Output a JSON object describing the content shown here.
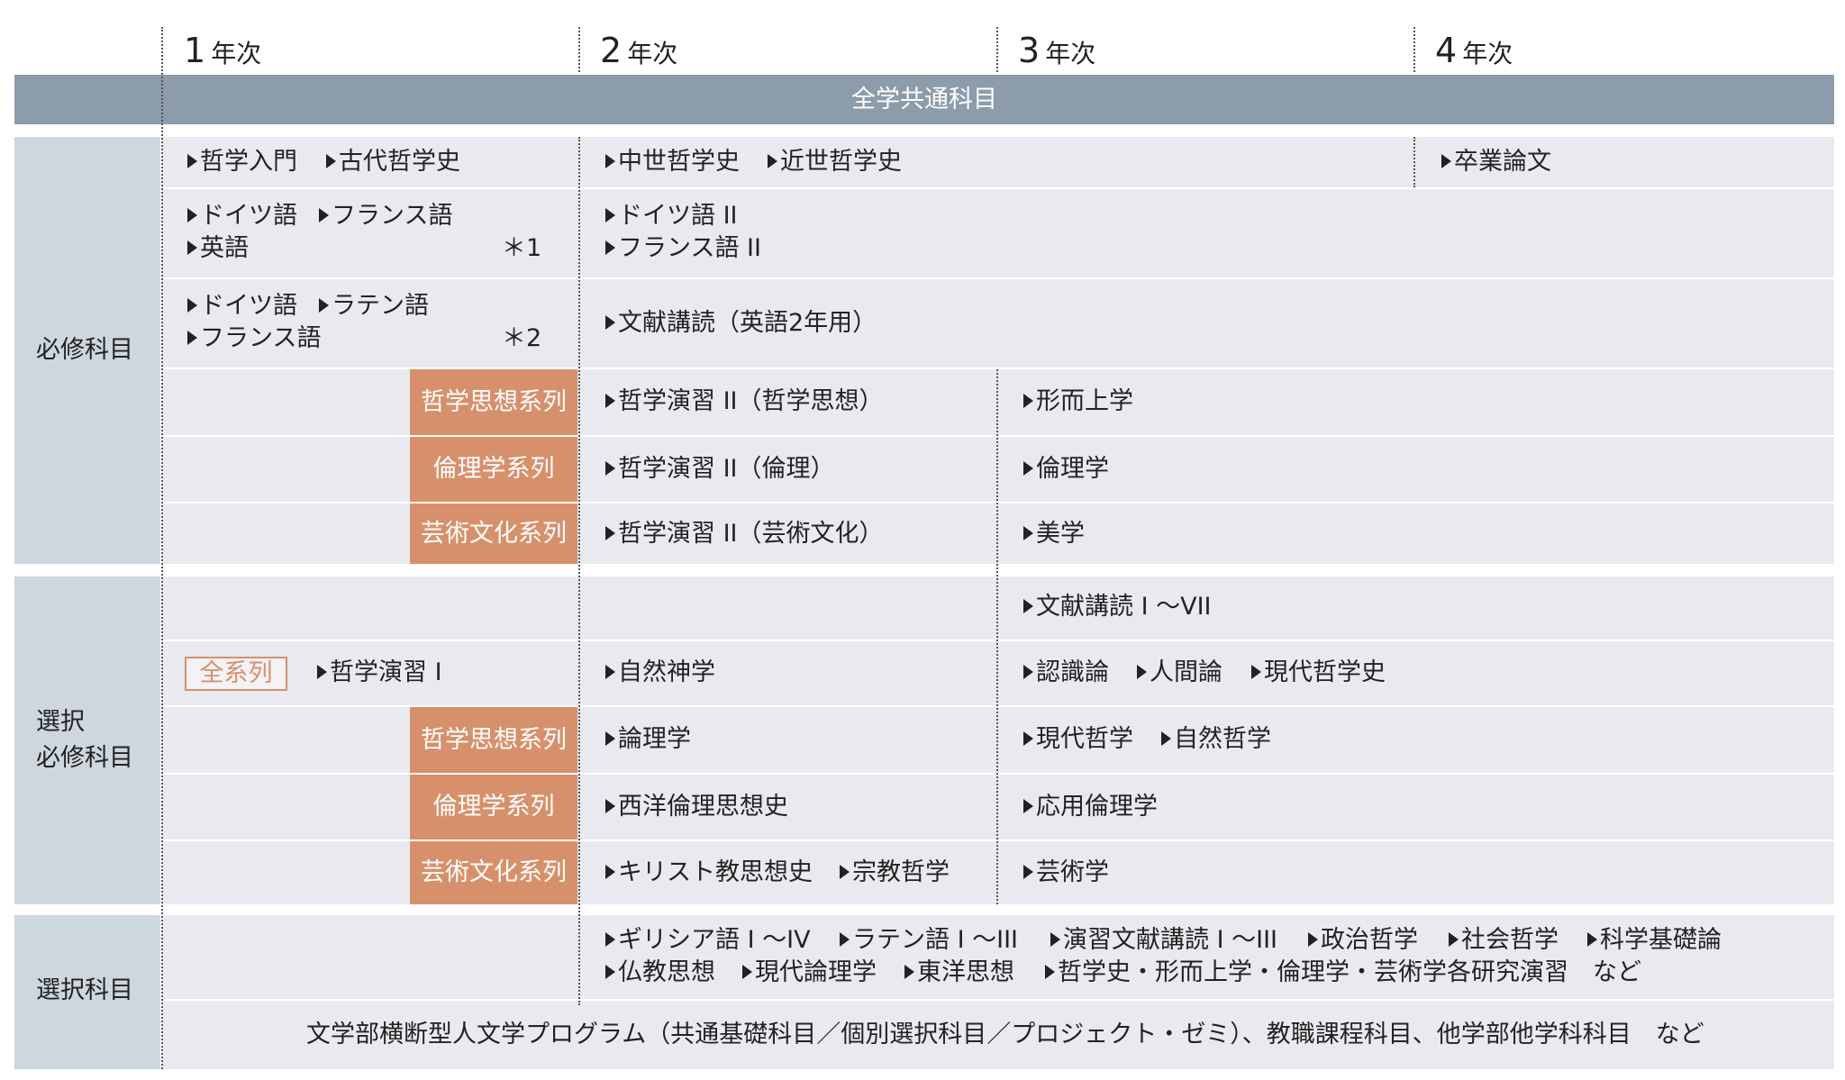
{
  "years": {
    "y1": {
      "num": "1",
      "label": "年次"
    },
    "y2": {
      "num": "2",
      "label": "年次"
    },
    "y3": {
      "num": "3",
      "label": "年次"
    },
    "y4": {
      "num": "4",
      "label": "年次"
    }
  },
  "common_band": "全学共通科目",
  "categories": {
    "required": "必修科目",
    "selective_required_1": "選択",
    "selective_required_2": "必修科目",
    "elective": "選択科目"
  },
  "series": {
    "philosophy": "哲学思想系列",
    "ethics": "倫理学系列",
    "art": "芸術文化系列",
    "all": "全系列"
  },
  "notes": {
    "n1": "＊1",
    "n2": "＊2"
  },
  "required": {
    "r1_y1_a": "哲学入門",
    "r1_y1_b": "古代哲学史",
    "r1_y2_a": "中世哲学史",
    "r1_y2_b": "近世哲学史",
    "r1_y4": "卒業論文",
    "r2_y1_a": "ドイツ語",
    "r2_y1_b": "フランス語",
    "r2_y1_c": "英語",
    "r2_y2_a": "ドイツ語 II",
    "r2_y2_b": "フランス語 II",
    "r3_y1_a": "ドイツ語",
    "r3_y1_b": "ラテン語",
    "r3_y1_c": "フランス語",
    "r3_y2": "文献講読（英語2年用）",
    "r4_y2": "哲学演習 II（哲学思想）",
    "r4_y3": "形而上学",
    "r5_y2": "哲学演習 II（倫理）",
    "r5_y3": "倫理学",
    "r6_y2": "哲学演習 II（芸術文化）",
    "r6_y3": "美学"
  },
  "selective": {
    "s1_y3": "文献講読 I 〜VII",
    "s2_y1": "哲学演習 I",
    "s2_y2": "自然神学",
    "s2_y3_a": "認識論",
    "s2_y3_b": "人間論",
    "s2_y3_c": "現代哲学史",
    "s3_y2": "論理学",
    "s3_y3_a": "現代哲学",
    "s3_y3_b": "自然哲学",
    "s4_y2": "西洋倫理思想史",
    "s4_y3": "応用倫理学",
    "s5_y2_a": "キリスト教思想史",
    "s5_y2_b": "宗教哲学",
    "s5_y3": "芸術学"
  },
  "elective": {
    "e_a": "ギリシア語 I 〜IV",
    "e_b": "ラテン語 I 〜III",
    "e_c": "演習文献講読 I 〜III",
    "e_d": "政治哲学",
    "e_e": "社会哲学",
    "e_f": "科学基礎論",
    "e_g": "仏教思想",
    "e_h": "現代論理学",
    "e_i": "東洋思想",
    "e_j": "哲学史・形而上学・倫理学・芸術学各研究演習　など",
    "bottom": "文学部横断型人文学プログラム（共通基礎科目／個別選択科目／プロジェクト・ゼミ）、教職課程科目、他学部他学科科目　など"
  },
  "colors": {
    "band": "#8c9caa",
    "side": "#ced6de",
    "row": "#e9eaef",
    "badge": "#d7906c"
  }
}
